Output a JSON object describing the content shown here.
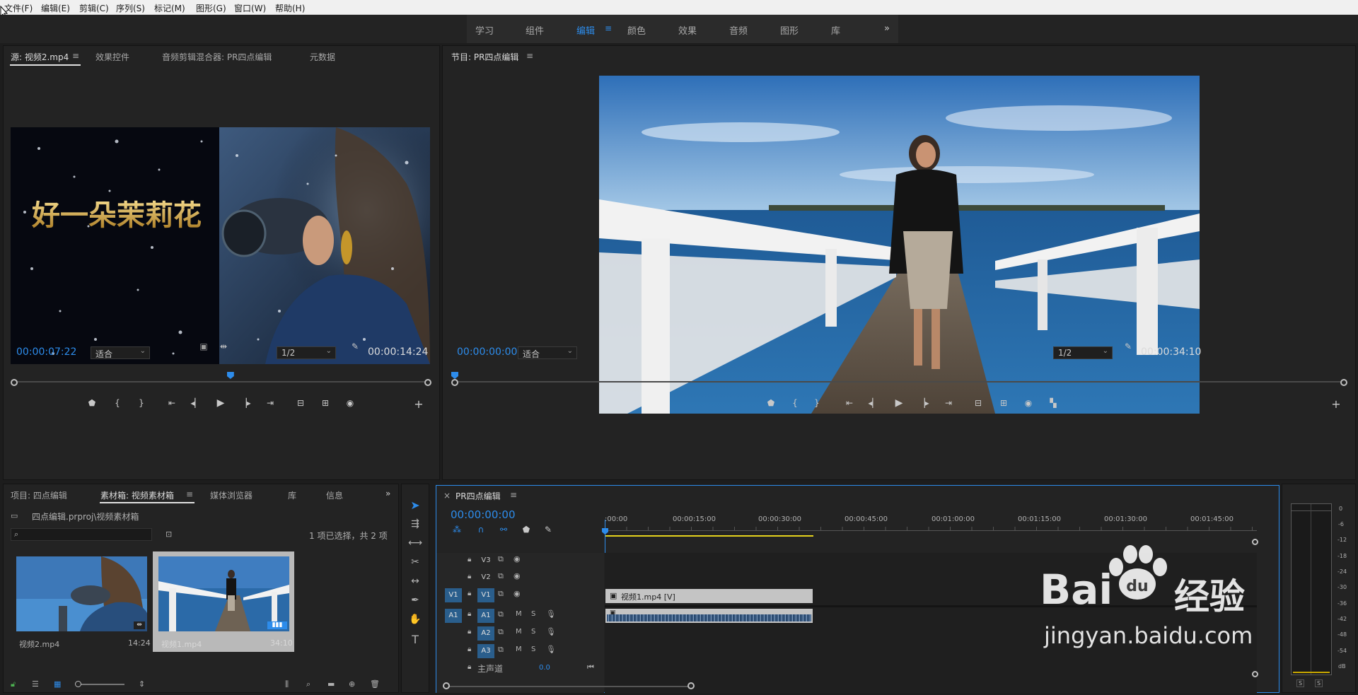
{
  "menu": [
    "文件(F)",
    "编辑(E)",
    "剪辑(C)",
    "序列(S)",
    "标记(M)",
    "图形(G)",
    "窗口(W)",
    "帮助(H)"
  ],
  "workspaces": {
    "tabs": [
      "学习",
      "组件",
      "编辑",
      "颜色",
      "效果",
      "音频",
      "图形",
      "库"
    ],
    "active": "编辑",
    "more": "»"
  },
  "source_panel": {
    "tabs": [
      "源: 视频2.mp4",
      "效果控件",
      "音频剪辑混合器: PR四点编辑",
      "元数据"
    ],
    "preview_text": "好一朵茉莉花",
    "timecode_in": "00:00:07:22",
    "fit": "适合",
    "resolution": "1/2",
    "timecode_out": "00:00:14:24",
    "playhead_fraction": 0.52
  },
  "program_panel": {
    "tab": "节目: PR四点编辑",
    "timecode_in": "00:00:00:00",
    "fit": "适合",
    "resolution": "1/2",
    "timecode_out": "00:00:34:10"
  },
  "project_panel": {
    "tabs": [
      "项目: 四点编辑",
      "素材箱: 视频素材箱",
      "媒体浏览器",
      "库",
      "信息"
    ],
    "path": "四点编辑.prproj\\视频素材箱",
    "search_placeholder": "",
    "selection_status": "1 项已选择，共 2 项",
    "items": [
      {
        "name": "视频2.mp4",
        "duration": "14:24"
      },
      {
        "name": "视频1.mp4",
        "duration": "34:10"
      }
    ]
  },
  "timeline": {
    "tab_close": "×",
    "sequence_name": "PR四点编辑",
    "timecode": "00:00:00:00",
    "ruler": [
      ":00:00",
      "00:00:15:00",
      "00:00:30:00",
      "00:00:45:00",
      "00:01:00:00",
      "00:01:15:00",
      "00:01:30:00",
      "00:01:45:00"
    ],
    "video_tracks": [
      {
        "src": "",
        "name": "V3"
      },
      {
        "src": "",
        "name": "V2"
      },
      {
        "src": "V1",
        "name": "V1"
      }
    ],
    "audio_tracks": [
      {
        "src": "A1",
        "name": "A1",
        "m": "M",
        "s": "S"
      },
      {
        "src": "",
        "name": "A2",
        "m": "M",
        "s": "S"
      },
      {
        "src": "",
        "name": "A3",
        "m": "M",
        "s": "S"
      }
    ],
    "master_label": "主声道",
    "master_value": "0.0",
    "video_clip_label": "视频1.mp4 [V]",
    "work_area_fraction": 0.32
  },
  "audio_meter": {
    "scale": [
      "0",
      "-6",
      "-12",
      "-18",
      "-24",
      "-30",
      "-36",
      "-42",
      "-48",
      "-54",
      "dB"
    ],
    "solo": [
      "S",
      "S"
    ]
  },
  "watermark": {
    "brand_1": "Bai",
    "brand_2": "经验",
    "url": "jingyan.baidu.com"
  },
  "colors": {
    "accent": "#2d8ceb",
    "panel": "#232323",
    "track_on": "#2a5e8c",
    "clip_video": "#c4c4c4"
  }
}
